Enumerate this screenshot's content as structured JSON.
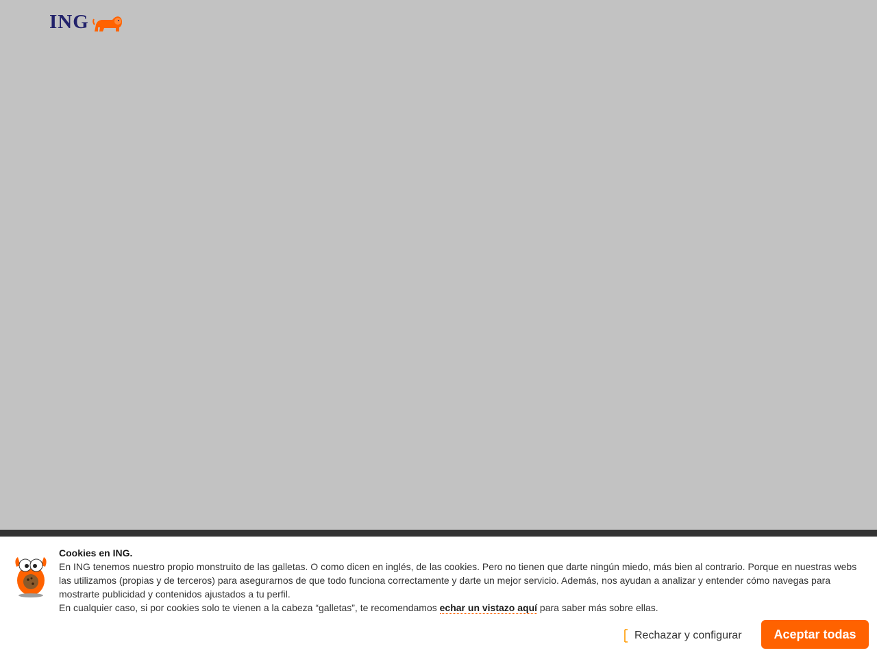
{
  "header": {
    "logo_text": "ING",
    "logo_icon": "lion-icon"
  },
  "cookie_banner": {
    "title": "Cookies en ING.",
    "paragraph_1": "En ING tenemos nuestro propio monstruito de las galletas. O como dicen en inglés, de las cookies. Pero no tienen que darte ningún miedo, más bien al contrario. Porque en nuestras webs las utilizamos (propias y de terceros) para asegurarnos de que todo funciona correctamente y darte un mejor servicio. Además, nos ayudan a analizar y entender cómo navegas para mostrarte publicidad y contenidos ajustados a tu perfil.",
    "paragraph_2_before": "En cualquier caso, si por cookies solo te vienen a la cabeza “galletas”, te recomendamos ",
    "paragraph_2_link": "echar un vistazo aquí",
    "paragraph_2_after": " para saber más sobre ellas.",
    "reject_label": "Rechazar y configurar",
    "reject_icon": "chevron-icon",
    "accept_label": "Aceptar todas",
    "mascot_icon": "cookie-monster-icon"
  },
  "colors": {
    "backdrop": "#c2c2c2",
    "brand_orange": "#ff6200",
    "brand_navy": "#22226b",
    "topbar": "#333333"
  }
}
